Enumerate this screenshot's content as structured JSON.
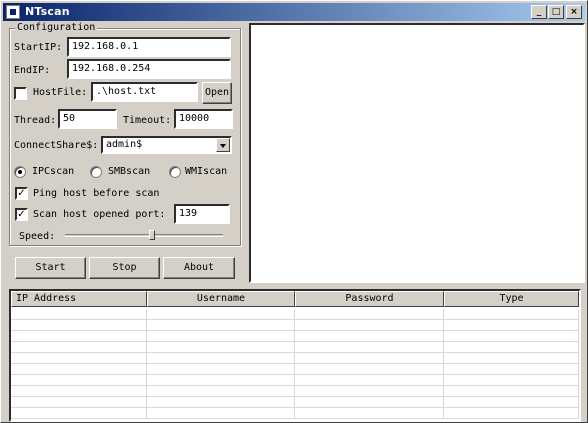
{
  "window": {
    "title": "NTscan"
  },
  "config": {
    "legend": "Configuration",
    "start_ip_label": "StartIP:",
    "start_ip_value": "192.168.0.1",
    "end_ip_label": "EndIP:",
    "end_ip_value": "192.168.0.254",
    "hostfile_label": "HostFile:",
    "hostfile_value": ".\\host.txt",
    "open_label": "Open",
    "thread_label": "Thread:",
    "thread_value": "50",
    "timeout_label": "Timeout:",
    "timeout_value": "10000",
    "connectshare_label": "ConnectShare$:",
    "connectshare_value": "admin$",
    "scan_modes": [
      "IPCscan",
      "SMBscan",
      "WMIscan"
    ],
    "selected_mode": "IPCscan",
    "ping_label": "Ping host before scan",
    "ping_checked": true,
    "scan_port_label": "Scan host opened port:",
    "scan_port_checked": true,
    "port_value": "139",
    "hostfile_checked": false,
    "speed_label": "Speed:",
    "speed_level": 0.55
  },
  "buttons": {
    "start": "Start",
    "stop": "Stop",
    "about": "About"
  },
  "grid": {
    "columns": [
      "IP Address",
      "Username",
      "Password",
      "Type"
    ],
    "rows": []
  }
}
